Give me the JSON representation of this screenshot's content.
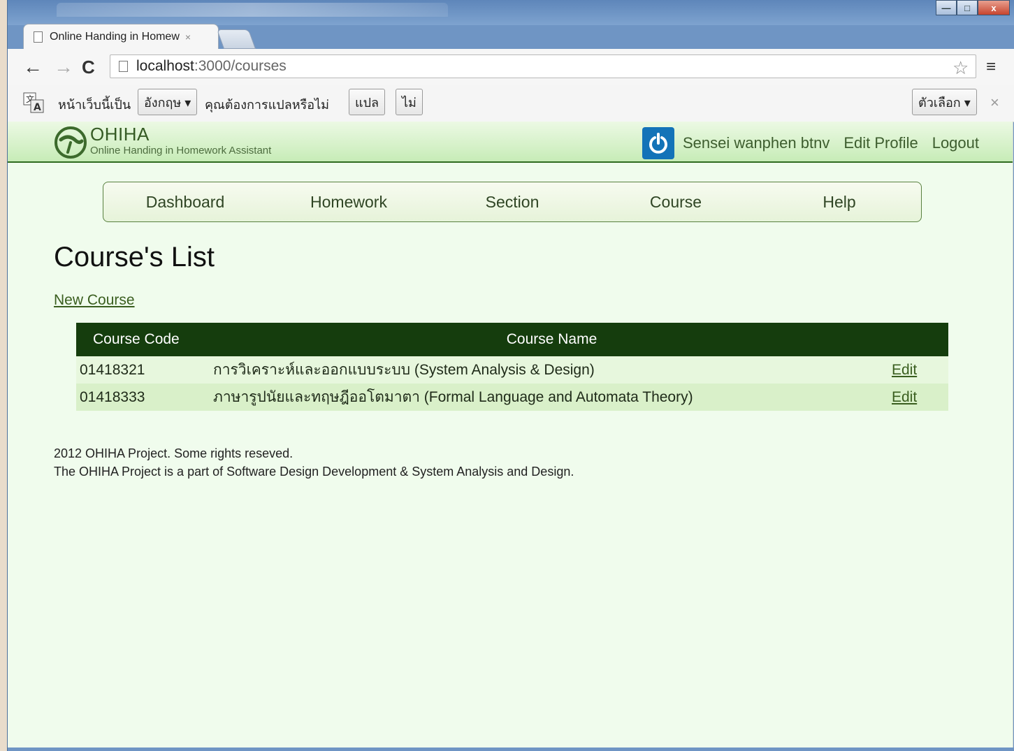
{
  "browser": {
    "tab_title": "Online Handing in Homew",
    "tab_close": "×",
    "url_host": "localhost",
    "url_path": ":3000/courses",
    "back": "←",
    "forward": "→",
    "reload": "C",
    "star": "☆",
    "menu": "≡",
    "window_controls": {
      "minimize": "—",
      "maximize": "□",
      "close": "x"
    }
  },
  "translate_bar": {
    "prefix_text": "หน้าเว็บนี้เป็น",
    "language_select": "อังกฤษ ▾",
    "question_text": "คุณต้องการแปลหรือไม่",
    "translate_button": "แปล",
    "no_button": "ไม่",
    "options_button": "ตัวเลือก ▾",
    "close": "×"
  },
  "header": {
    "logo_title": "OHIHA",
    "logo_subtitle": "Online Handing in Homework Assistant",
    "user_name": "Sensei wanphen btnv",
    "edit_profile": "Edit Profile",
    "logout": "Logout"
  },
  "nav": {
    "items": [
      "Dashboard",
      "Homework",
      "Section",
      "Course",
      "Help"
    ]
  },
  "main": {
    "title": "Course's List",
    "new_course_link": "New Course",
    "table": {
      "headers": [
        "Course Code",
        "Course Name",
        ""
      ],
      "rows": [
        {
          "code": "01418321",
          "name": "การวิเคราะห์และออกแบบระบบ (System Analysis & Design)",
          "action": "Edit"
        },
        {
          "code": "01418333",
          "name": "ภาษารูปนัยและทฤษฎีออโตมาตา (Formal Language and Automata Theory)",
          "action": "Edit"
        }
      ]
    }
  },
  "footer": {
    "line1": "2012 OHIHA Project. Some rights reseved.",
    "line2": "The OHIHA Project is a part of Software Design Development & System Analysis and Design."
  },
  "colors": {
    "header_bg": "#c7ecb7",
    "table_header": "#153d0d",
    "page_bg": "#f0fced",
    "accent_link": "#3a5e1f",
    "power_icon": "#1373b8"
  },
  "icons": [
    "page-icon",
    "back-icon",
    "forward-icon",
    "reload-icon",
    "star-icon",
    "menu-icon",
    "translate-icon",
    "power-icon",
    "ohiha-logo-icon"
  ]
}
